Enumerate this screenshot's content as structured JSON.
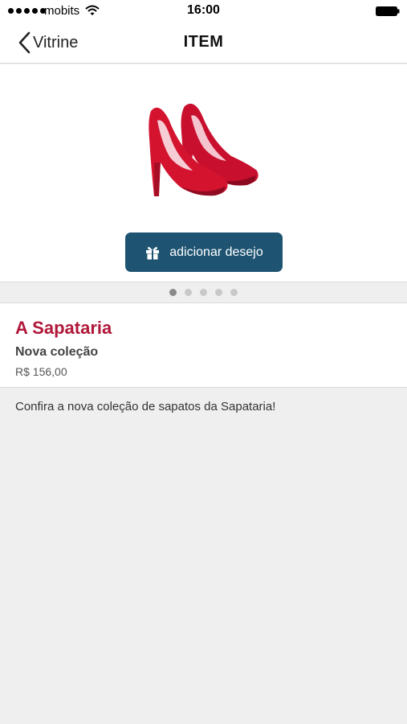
{
  "status_bar": {
    "carrier": "mobits",
    "time": "16:00"
  },
  "nav": {
    "back_label": "Vitrine",
    "title": "ITEM"
  },
  "product": {
    "image_icon": "red-high-heels-image",
    "wish_button_label": "adicionar desejo",
    "wish_button_icon": "gift-icon",
    "gallery_pages": 5,
    "gallery_active_page": 1
  },
  "info": {
    "store_name": "A Sapataria",
    "collection": "Nova coleção",
    "price": "R$ 156,00"
  },
  "description": "Confira a nova coleção de sapatos da Sapataria!",
  "colors": {
    "accent": "#1e5472",
    "store_name": "#b0173a",
    "background": "#efefef"
  }
}
